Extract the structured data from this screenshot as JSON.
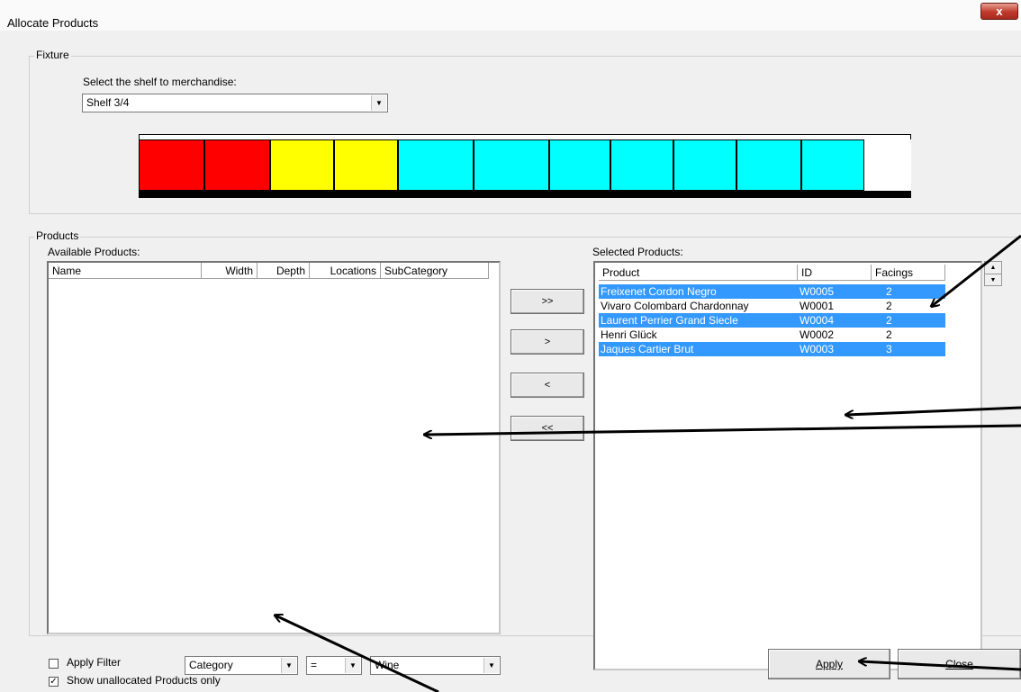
{
  "window": {
    "title": "Allocate Products",
    "close_glyph": "x"
  },
  "fixture": {
    "group_label": "Fixture",
    "shelf_prompt": "Select the shelf to merchandise:",
    "shelf_selected": "Shelf 3/4",
    "shelf_slots": [
      {
        "color": "#ff0000"
      },
      {
        "color": "#ff0000"
      },
      {
        "color": "#ffff00"
      },
      {
        "color": "#ffff00"
      },
      {
        "color": "#00ffff"
      },
      {
        "color": "#00ffff"
      },
      {
        "color": "#00ffff"
      },
      {
        "color": "#00ffff"
      },
      {
        "color": "#00ffff"
      },
      {
        "color": "#00ffff"
      },
      {
        "color": "#00ffff"
      },
      {
        "color": "#ffffff"
      }
    ]
  },
  "products": {
    "group_label": "Products",
    "available_label": "Available Products:",
    "available_columns": [
      "Name",
      "Width",
      "Depth",
      "Locations",
      "SubCategory"
    ],
    "selected_label": "Selected Products:",
    "selected_columns": [
      "Product",
      "ID",
      "Facings"
    ],
    "selected_rows": [
      {
        "product": "Freixenet Cordon Negro",
        "id": "W0005",
        "facings": "2",
        "selected": true
      },
      {
        "product": "Vivaro Colombard Chardonnay",
        "id": "W0001",
        "facings": "2",
        "selected": false
      },
      {
        "product": "Laurent Perrier Grand Siecle",
        "id": "W0004",
        "facings": "2",
        "selected": true
      },
      {
        "product": "Henri Glück",
        "id": "W0002",
        "facings": "2",
        "selected": false
      },
      {
        "product": "Jaques Cartier Brut",
        "id": "W0003",
        "facings": "3",
        "selected": true
      }
    ],
    "move_buttons": {
      "add_all": ">>",
      "add": ">",
      "remove": "<",
      "remove_all": "<<"
    },
    "filter": {
      "apply_filter_label": "Apply Filter",
      "apply_filter_checked": false,
      "field": "Category",
      "operator": "=",
      "value": "Wine"
    },
    "show_unallocated_label": "Show unallocated Products only",
    "show_unallocated_checked": true
  },
  "footer": {
    "apply_label": "Apply",
    "close_label": "Close"
  }
}
